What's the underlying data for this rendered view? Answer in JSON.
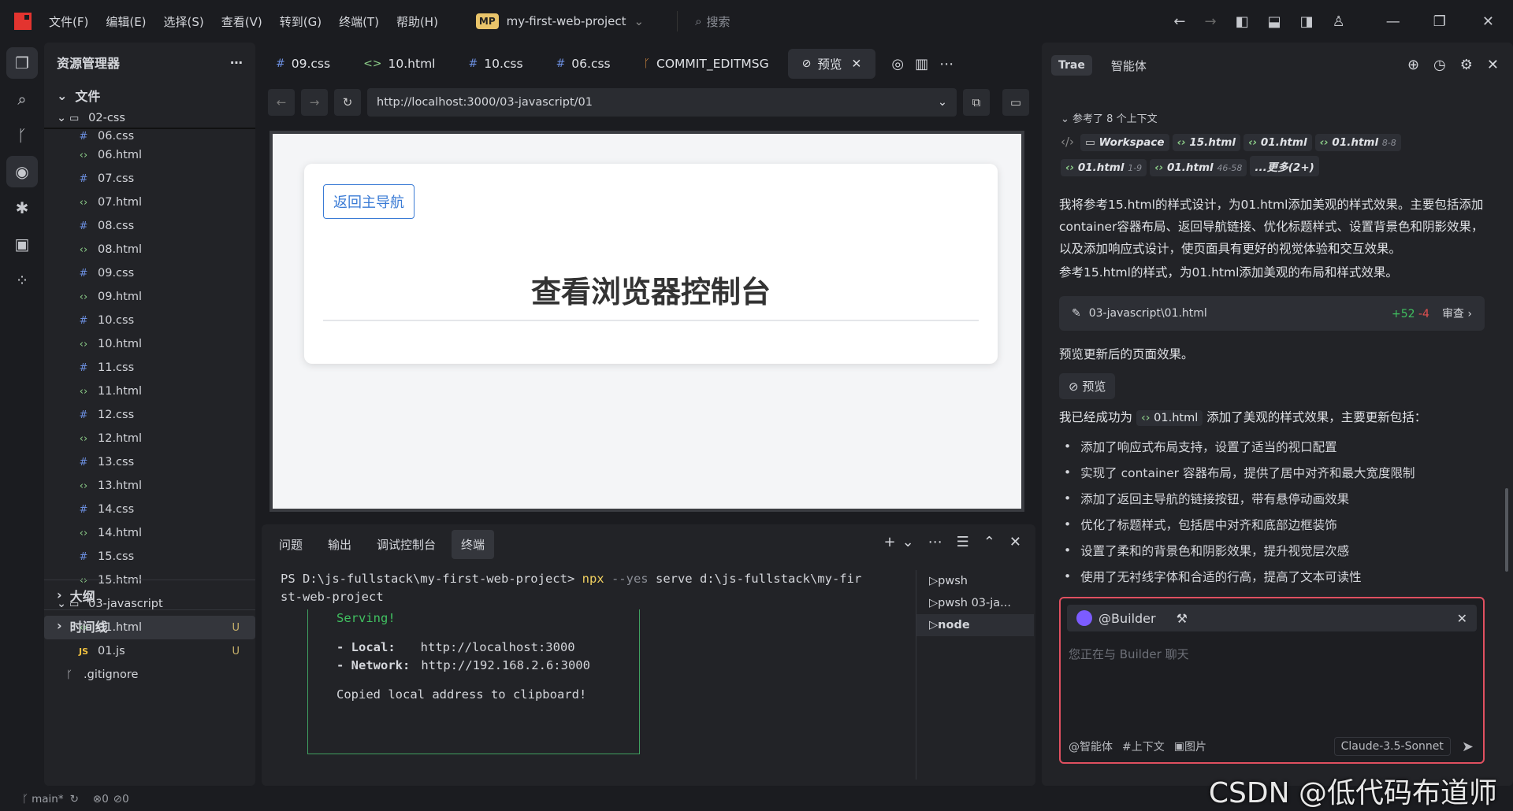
{
  "titlebar": {
    "menu": [
      "文件(F)",
      "编辑(E)",
      "选择(S)",
      "查看(V)",
      "转到(G)",
      "终端(T)",
      "帮助(H)"
    ],
    "project_badge": "MP",
    "project": "my-first-web-project",
    "search": "搜索"
  },
  "explorer": {
    "title": "资源管理器",
    "files_section": "文件",
    "folder1": "02-css",
    "files": [
      {
        "n": "06.css",
        "t": "css"
      },
      {
        "n": "06.html",
        "t": "html"
      },
      {
        "n": "07.css",
        "t": "css"
      },
      {
        "n": "07.html",
        "t": "html"
      },
      {
        "n": "08.css",
        "t": "css"
      },
      {
        "n": "08.html",
        "t": "html"
      },
      {
        "n": "09.css",
        "t": "css"
      },
      {
        "n": "09.html",
        "t": "html"
      },
      {
        "n": "10.css",
        "t": "css"
      },
      {
        "n": "10.html",
        "t": "html"
      },
      {
        "n": "11.css",
        "t": "css"
      },
      {
        "n": "11.html",
        "t": "html"
      },
      {
        "n": "12.css",
        "t": "css"
      },
      {
        "n": "12.html",
        "t": "html"
      },
      {
        "n": "13.css",
        "t": "css"
      },
      {
        "n": "13.html",
        "t": "html"
      },
      {
        "n": "14.css",
        "t": "css"
      },
      {
        "n": "14.html",
        "t": "html"
      },
      {
        "n": "15.css",
        "t": "css"
      },
      {
        "n": "15.html",
        "t": "html"
      }
    ],
    "folder2": "03-javascript",
    "js_files": [
      {
        "n": "01.html",
        "t": "html",
        "s": "U"
      },
      {
        "n": "01.js",
        "t": "js",
        "s": "U"
      }
    ],
    "gitignore": ".gitignore",
    "outline": "大纲",
    "timeline": "时间线"
  },
  "tabs": [
    {
      "label": "09.css",
      "icon": "#"
    },
    {
      "label": "10.html",
      "icon": "<>"
    },
    {
      "label": "10.css",
      "icon": "#"
    },
    {
      "label": "06.css",
      "icon": "#"
    },
    {
      "label": "COMMIT_EDITMSG",
      "icon": "ᚴ"
    }
  ],
  "preview_tab": "预览",
  "url": "http://localhost:3000/03-javascript/01",
  "page": {
    "back": "返回主导航",
    "heading": "查看浏览器控制台"
  },
  "panel": {
    "tabs": [
      "问题",
      "输出",
      "调试控制台",
      "终端"
    ],
    "cmd_prompt": "PS D:\\js-fullstack\\my-first-web-project>",
    "cmd_npx": "npx",
    "cmd_flag": "--yes",
    "cmd_rest": "serve d:\\js-fullstack\\my-fir",
    "cmd_wrap": "st-web-project",
    "serving": "Serving!",
    "local_label": "- Local:",
    "local_url": "http://localhost:3000",
    "net_label": "- Network:",
    "net_url": "http://192.168.2.6:3000",
    "copied": "Copied local address to clipboard!",
    "terms": [
      "pwsh",
      "pwsh 03-ja...",
      "node"
    ]
  },
  "chat": {
    "tab1": "Trae",
    "tab2": "智能体",
    "context": "参考了 8 个上下文",
    "chips": [
      {
        "l": "Workspace",
        "r": ""
      },
      {
        "l": "15.html",
        "r": ""
      },
      {
        "l": "01.html",
        "r": ""
      },
      {
        "l": "01.html",
        "r": "8-8"
      },
      {
        "l": "01.html",
        "r": "1-9"
      },
      {
        "l": "01.html",
        "r": "46-58"
      },
      {
        "l": "...更多(2+)",
        "r": ""
      }
    ],
    "msg1": "我将参考15.html的样式设计，为01.html添加美观的样式效果。主要包括添加container容器布局、返回导航链接、优化标题样式、设置背景色和阴影效果，以及添加响应式设计，使页面具有更好的视觉体验和交互效果。",
    "msg2": "参考15.html的样式，为01.html添加美观的布局和样式效果。",
    "file": "03-javascript\\01.html",
    "plus": "+52",
    "minus": "-4",
    "review": "审查",
    "msg3": "预览更新后的页面效果。",
    "preview_btn": "预览",
    "msg4a": "我已经成功为",
    "msg4chip": "01.html",
    "msg4b": "添加了美观的样式效果，主要更新包括：",
    "bullets": [
      "添加了响应式布局支持，设置了适当的视口配置",
      "实现了 container 容器布局，提供了居中对齐和最大宽度限制",
      "添加了返回主导航的链接按钮，带有悬停动画效果",
      "优化了标题样式，包括居中对齐和底部边框装饰",
      "设置了柔和的背景色和阴影效果，提升视觉层次感",
      "使用了无衬线字体和合适的行高，提高了文本可读性"
    ],
    "builder": "@Builder",
    "placeholder": "您正在与 Builder 聊天",
    "agent": "@智能体",
    "ctxbtn": "#上下文",
    "img": "图片",
    "model": "Claude-3.5-Sonnet"
  },
  "status": {
    "branch": "main*",
    "errors": "0",
    "warnings": "0"
  },
  "watermark": "CSDN @低代码布道师"
}
